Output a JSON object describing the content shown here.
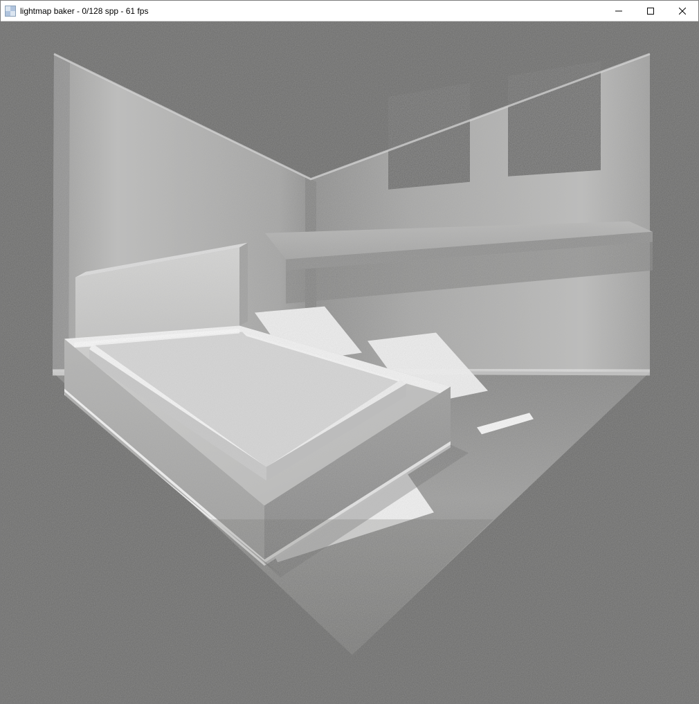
{
  "window": {
    "title": "lightmap baker - 0/128 spp - 61 fps",
    "app_name": "lightmap baker",
    "spp_current": 0,
    "spp_total": 128,
    "fps": 61,
    "controls": {
      "minimize_icon": "minimize-icon",
      "maximize_icon": "maximize-icon",
      "close_icon": "close-icon"
    }
  },
  "viewport": {
    "background_color": "#6a6a69",
    "scene_description": "3d-rendered-room-with-bed-shelf-windows"
  }
}
